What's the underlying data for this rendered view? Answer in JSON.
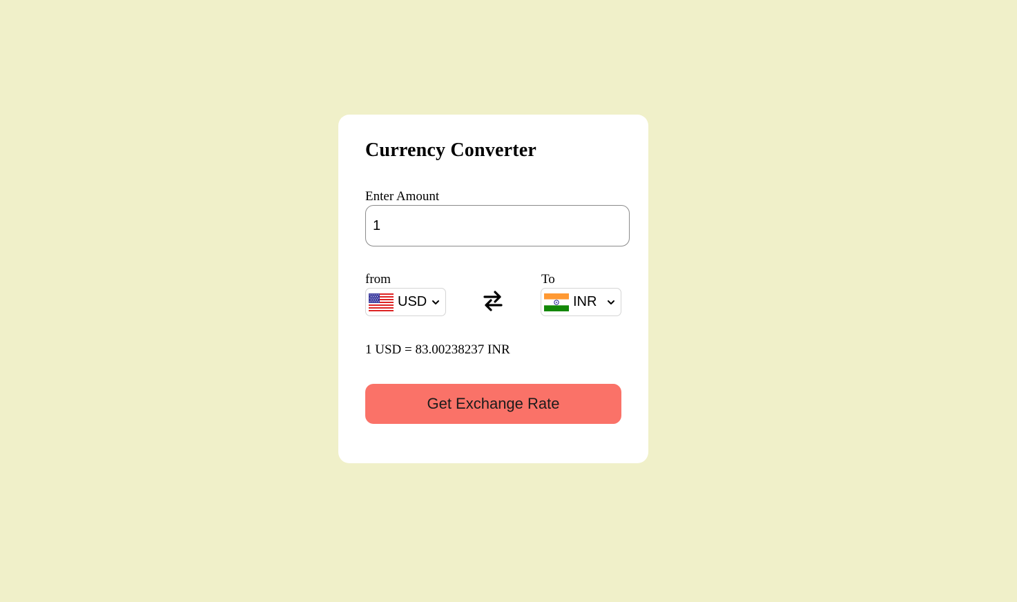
{
  "app": {
    "title": "Currency Converter"
  },
  "amount": {
    "label": "Enter Amount",
    "value": "1"
  },
  "from": {
    "label": "from",
    "selected": "USD",
    "flag_icon": "us-flag-icon"
  },
  "to": {
    "label": "To",
    "selected": "INR",
    "flag_icon": "india-flag-icon"
  },
  "result": {
    "text": "1 USD = 83.00238237 INR"
  },
  "actions": {
    "submit_label": "Get Exchange Rate"
  },
  "colors": {
    "page_background": "#f0f0c9",
    "card_background": "#ffffff",
    "button_background": "#fa7268"
  }
}
